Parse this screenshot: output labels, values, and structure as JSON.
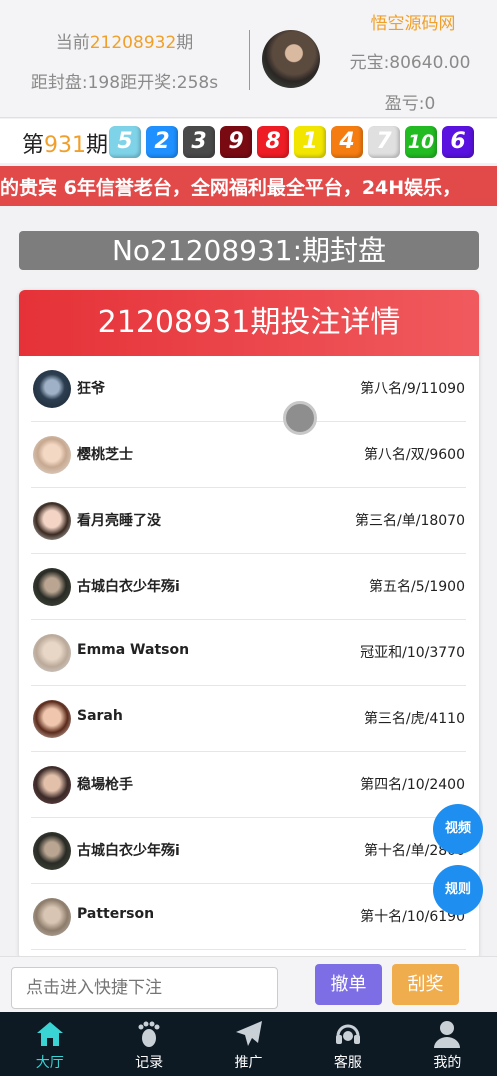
{
  "header": {
    "period_prefix": "当前",
    "period_number": "21208932",
    "period_suffix": "期",
    "countdown": "距封盘:198距开奖:258s",
    "site_name": "悟空源码网",
    "balance": "元宝:80640.00",
    "profit": "盈亏:0"
  },
  "draw": {
    "prefix": "第",
    "number": "931",
    "suffix": "期",
    "balls": [
      {
        "value": "5",
        "color": "#7fd3e8",
        "text_color": "#ffffff"
      },
      {
        "value": "2",
        "color": "#1e90ff",
        "text_color": "#ffffff"
      },
      {
        "value": "3",
        "color": "#4a4a4a",
        "text_color": "#ffffff"
      },
      {
        "value": "9",
        "color": "#7a0a12",
        "text_color": "#ffffff"
      },
      {
        "value": "8",
        "color": "#ee1c24",
        "text_color": "#ffffff"
      },
      {
        "value": "1",
        "color": "#f2e600",
        "text_color": "#ffffff"
      },
      {
        "value": "4",
        "color": "#f57c10",
        "text_color": "#ffffff"
      },
      {
        "value": "7",
        "color": "#e0e0e0",
        "text_color": "#ffffff"
      },
      {
        "value": "10",
        "color": "#22bb22",
        "text_color": "#ffffff"
      },
      {
        "value": "6",
        "color": "#5a12e0",
        "text_color": "#ffffff"
      }
    ]
  },
  "marquee": {
    "text": "的贵宾 6年信誉老台，全网福利最全平台，24H娱乐，"
  },
  "status": {
    "text": "No21208931:期封盘"
  },
  "bets": {
    "title": "21208931期投注详情",
    "rows": [
      {
        "name": "狂爷",
        "detail": "第八名/9/11090"
      },
      {
        "name": "樱桃芝士",
        "detail": "第八名/双/9600"
      },
      {
        "name": "看月亮睡了没",
        "detail": "第三名/单/18070"
      },
      {
        "name": "古城白衣少年殇i",
        "detail": "第五名/5/1900"
      },
      {
        "name": "Emma Watson",
        "detail": "冠亚和/10/3770"
      },
      {
        "name": "Sarah",
        "detail": "第三名/虎/4110"
      },
      {
        "name": "稳場枪手",
        "detail": "第四名/10/2400"
      },
      {
        "name": "古城白衣少年殇i",
        "detail": "第十名/单/2800"
      },
      {
        "name": "Patterson",
        "detail": "第十名/10/6190"
      }
    ]
  },
  "floating": {
    "video": "视频",
    "rules": "规则"
  },
  "quick": {
    "placeholder": "点击进入快捷下注",
    "cancel": "撤单",
    "scratch": "刮奖"
  },
  "tabs": [
    {
      "label": "大厅",
      "icon": "home-icon",
      "active": true
    },
    {
      "label": "记录",
      "icon": "footprint-icon",
      "active": false
    },
    {
      "label": "推广",
      "icon": "paper-plane-icon",
      "active": false
    },
    {
      "label": "客服",
      "icon": "headset-icon",
      "active": false
    },
    {
      "label": "我的",
      "icon": "user-icon",
      "active": false
    }
  ],
  "colors": {
    "accent": "#f0a02a",
    "danger": "#e53238",
    "tab_active": "#3bd4d4",
    "fab": "#1e8ff0"
  }
}
